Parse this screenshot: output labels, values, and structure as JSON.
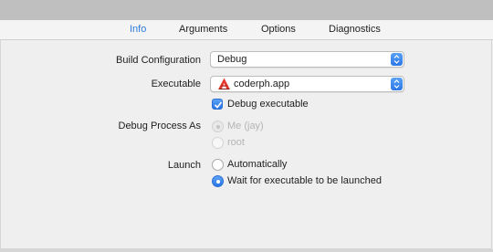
{
  "tabs": [
    {
      "label": "Info",
      "active": true
    },
    {
      "label": "Arguments",
      "active": false
    },
    {
      "label": "Options",
      "active": false
    },
    {
      "label": "Diagnostics",
      "active": false
    }
  ],
  "build_configuration": {
    "label": "Build Configuration",
    "value": "Debug"
  },
  "executable": {
    "label": "Executable",
    "value": "coderph.app",
    "icon": "app-icon"
  },
  "debug_executable": {
    "label": "Debug executable",
    "checked": true
  },
  "debug_process_as": {
    "label": "Debug Process As",
    "options": [
      {
        "label": "Me (jay)",
        "selected": true,
        "enabled": false
      },
      {
        "label": "root",
        "selected": false,
        "enabled": false
      }
    ]
  },
  "launch": {
    "label": "Launch",
    "options": [
      {
        "label": "Automatically",
        "selected": false
      },
      {
        "label": "Wait for executable to be launched",
        "selected": true
      }
    ]
  },
  "colors": {
    "accent": "#2f7bd9",
    "background": "#ececec",
    "disabled_text": "#b5b5b5"
  }
}
